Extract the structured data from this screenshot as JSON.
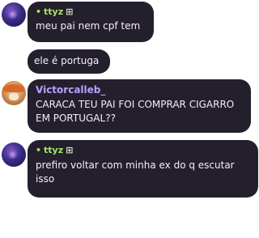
{
  "messages": [
    {
      "author": "ttyz",
      "badge": "⊞",
      "text": "meu pai nem cpf tem"
    },
    {
      "author": "",
      "text": "ele é portuga"
    },
    {
      "author": "Victorcalleb_",
      "text": "CARACA TEU PAI FOI COMPRAR CIGARRO EM PORTUGAL??"
    },
    {
      "author": "ttyz",
      "badge": "⊞",
      "text": "prefiro voltar com minha ex do q escutar isso"
    }
  ],
  "colors": {
    "bubble": "#241f2d",
    "text": "#f2f0f5",
    "name_green": "#a8e36a",
    "name_violet": "#b9a0ff"
  }
}
